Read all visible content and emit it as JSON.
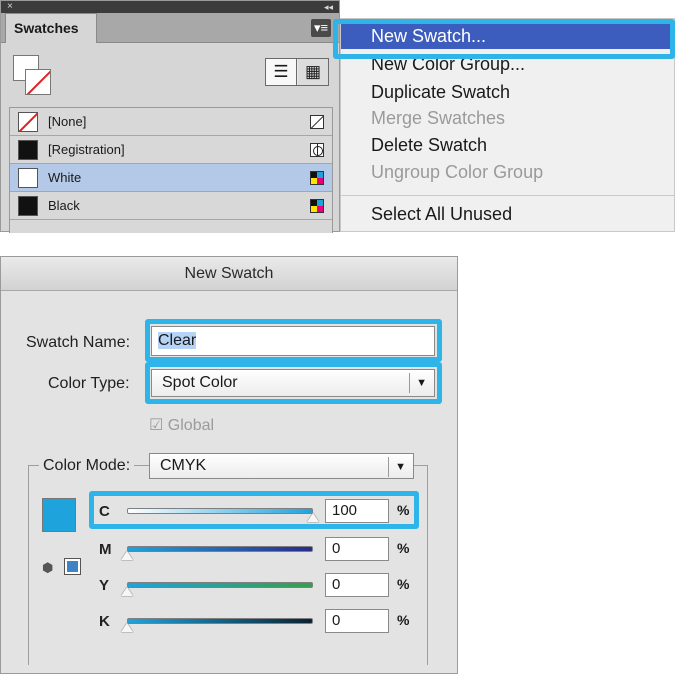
{
  "swatches_panel": {
    "close_glyph": "×",
    "collapse_glyph": "◂◂",
    "tab_label": "Swatches",
    "menu_glyph": "▾≡",
    "list_view_glyph": "☰",
    "grid_view_glyph": "▦",
    "rows": [
      {
        "label": "[None]",
        "chip": "none",
        "icon": "none-icon",
        "selected": false
      },
      {
        "label": "[Registration]",
        "chip": "black",
        "icon": "registration-icon",
        "selected": false
      },
      {
        "label": "White",
        "chip": "white",
        "icon": "process-color-icon",
        "selected": true
      },
      {
        "label": "Black",
        "chip": "black",
        "icon": "process-color-icon",
        "selected": false
      }
    ]
  },
  "context_menu": {
    "items": [
      {
        "label": "New Swatch...",
        "enabled": true,
        "highlighted": true
      },
      {
        "label": "New Color Group...",
        "enabled": true,
        "highlighted": false
      },
      {
        "label": "Duplicate Swatch",
        "enabled": true,
        "highlighted": false
      },
      {
        "label": "Merge Swatches",
        "enabled": false,
        "highlighted": false
      },
      {
        "label": "Delete Swatch",
        "enabled": true,
        "highlighted": false
      },
      {
        "label": "Ungroup Color Group",
        "enabled": false,
        "highlighted": false
      },
      {
        "label": "Select All Unused",
        "enabled": true,
        "highlighted": false
      }
    ]
  },
  "dialog": {
    "title": "New Swatch",
    "swatch_name_label": "Swatch Name:",
    "swatch_name_value": "Clear",
    "color_type_label": "Color Type:",
    "color_type_value": "Spot Color",
    "select_arrow": "▼",
    "global_label": "☑ Global",
    "global_checked": true,
    "global_enabled": false,
    "color_mode_label": "Color Mode:",
    "color_mode_value": "CMYK",
    "preview_color": "#1FA3DC",
    "cube_glyph": "⬢",
    "sliders": [
      {
        "letter": "C",
        "value": "100",
        "unit": "%",
        "fraction": 1.0,
        "gradient": "linear-gradient(90deg, #ffffff, #1fa3dc)"
      },
      {
        "letter": "M",
        "value": "0",
        "unit": "%",
        "fraction": 0.0,
        "gradient": "linear-gradient(90deg, #1fa3dc, #2a2a8a)"
      },
      {
        "letter": "Y",
        "value": "0",
        "unit": "%",
        "fraction": 0.0,
        "gradient": "linear-gradient(90deg, #1fa3dc, #35a04a)"
      },
      {
        "letter": "K",
        "value": "0",
        "unit": "%",
        "fraction": 0.0,
        "gradient": "linear-gradient(90deg, #1fa3dc, #0a2233)"
      }
    ]
  },
  "colors": {
    "callout_frame": "#2EB4E8",
    "menu_highlight": "#3D5DBE",
    "selected_row": "#B4C8E8"
  }
}
